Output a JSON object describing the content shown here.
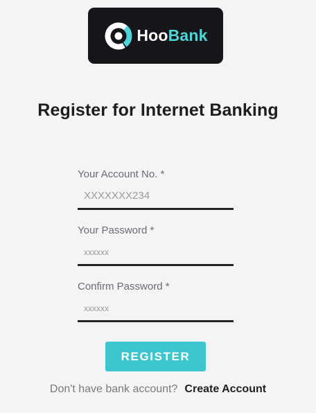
{
  "brand": {
    "name_part1": "Hoo",
    "name_part2": "Bank",
    "accent_color": "#4fd5d9",
    "logo_bg_color": "#15161a",
    "icon": "hoobank-logo-icon"
  },
  "page_title": "Register for Internet Banking",
  "form": {
    "account": {
      "label": "Your Account No. *",
      "placeholder": "XXXXXXX234"
    },
    "password": {
      "label": "Your Password *",
      "placeholder": "xxxxxx"
    },
    "confirm": {
      "label": "Confirm Password *",
      "placeholder": "xxxxxx"
    },
    "submit_label": "REGISTER",
    "submit_color": "#3cc4cf"
  },
  "footer": {
    "prompt": "Don't have bank account?",
    "link_label": "Create Account"
  }
}
